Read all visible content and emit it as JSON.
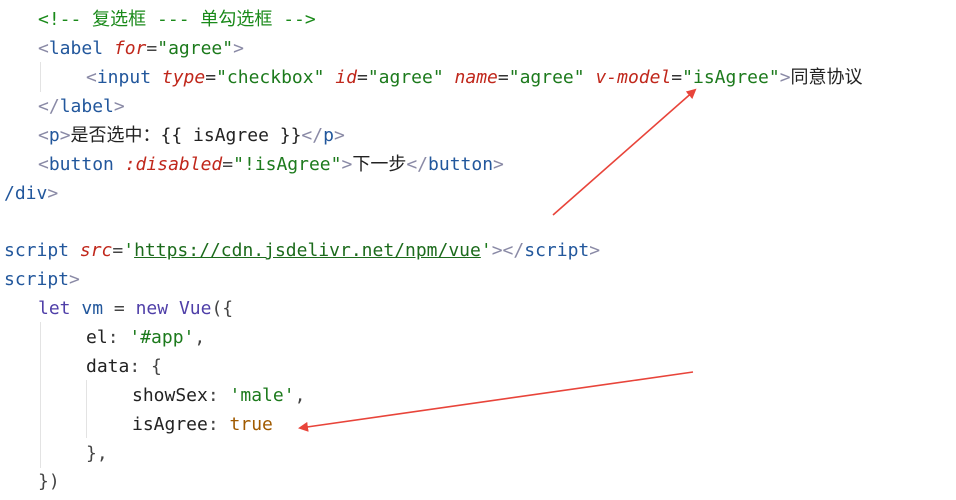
{
  "code": {
    "l1_comment": "<!-- 复选框 --- 单勾选框 -->",
    "l2": {
      "open": "<",
      "tag": "label",
      "attr": "for",
      "eq": "=",
      "value": "\"agree\"",
      "close": ">"
    },
    "l3": {
      "open": "<",
      "tag": "input",
      "a1": "type",
      "v1": "\"checkbox\"",
      "a2": "id",
      "v2": "\"agree\"",
      "a3": "name",
      "v3": "\"agree\"",
      "a4": "v-model",
      "v4": "\"isAgree\"",
      "close": ">",
      "text": "同意协议"
    },
    "l4": {
      "open": "</",
      "tag": "label",
      "close": ">"
    },
    "l5": {
      "open": "<",
      "tag": "p",
      "close": ">",
      "text": "是否选中：{{ isAgree }}",
      "end_open": "</",
      "end_tag": "p",
      "end_close": ">"
    },
    "l6": {
      "open": "<",
      "tag": "button",
      "attr": ":disabled",
      "eq": "=",
      "value": "\"!isAgree\"",
      "close": ">",
      "text": "下一步",
      "end_open": "</",
      "end_tag": "button",
      "end_close": ">"
    },
    "l7": {
      "tag": "/div",
      "close": ">"
    },
    "l8": {
      "tag": "script",
      "attr": "src",
      "eq": "=",
      "q": "'",
      "url": "https://cdn.jsdelivr.net/npm/vue",
      "close": ">",
      "end_open": "</",
      "end_tag": "script",
      "end_close": ">"
    },
    "l9": {
      "tag": "script",
      "close": ">"
    },
    "l10": {
      "kw_let": "let",
      "name": "vm",
      "eq": "=",
      "kw_new": "new",
      "cls": "Vue",
      "rest": "({"
    },
    "l11": {
      "key": "el",
      "colon": ": ",
      "str": "'#app'",
      "comma": ","
    },
    "l12": {
      "key": "data",
      "colon": ": ",
      "brace": "{"
    },
    "l13": {
      "key": "showSex",
      "colon": ": ",
      "str": "'male'",
      "comma": ","
    },
    "l14": {
      "key": "isAgree",
      "colon": ": ",
      "val": "true"
    },
    "l15": {
      "text": "},"
    },
    "l16": {
      "text": "})"
    }
  },
  "annotations": [
    {
      "name": "v-model-arrow",
      "color": "#e8443a"
    },
    {
      "name": "isAgree-arrow",
      "color": "#e8443a"
    }
  ]
}
